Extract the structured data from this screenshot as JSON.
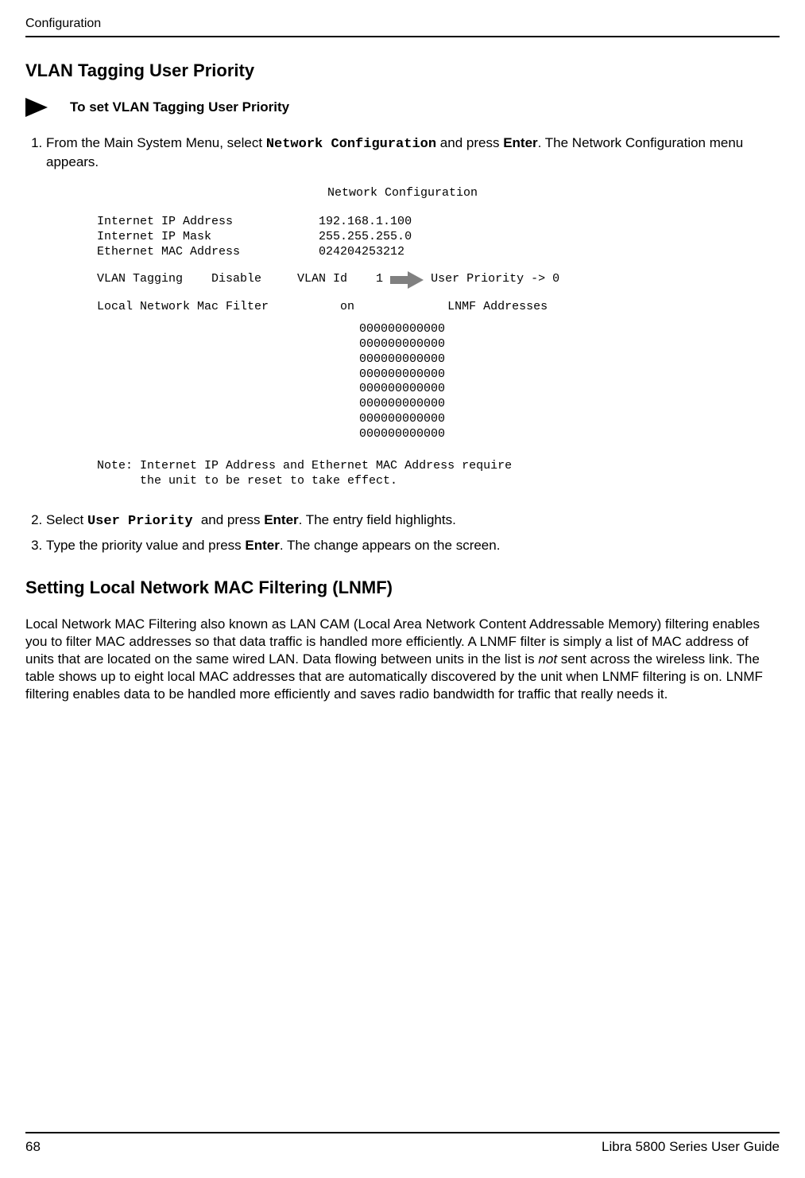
{
  "header": {
    "running": "Configuration"
  },
  "section1": {
    "title": "VLAN Tagging User Priority",
    "proc_title": "To set VLAN Tagging User Priority",
    "step1_a": "From the Main System Menu, select ",
    "step1_mono": "Network Configuration",
    "step1_b": " and press ",
    "step1_bold": "Enter",
    "step1_c": ".  The Network Configuration menu appears."
  },
  "screenshot": {
    "title": "Network Configuration",
    "lines_block1": [
      "Internet IP Address            192.168.1.100",
      "Internet IP Mask               255.255.255.0",
      "Ethernet MAC Address           024204253212"
    ],
    "vlan_left": "VLAN Tagging    Disable     VLAN Id    1 ",
    "vlan_right": " User Priority -> 0",
    "lnmf_line": "Local Network Mac Filter          on             LNMF Addresses",
    "lnmf_addrs": [
      "000000000000",
      "000000000000",
      "000000000000",
      "000000000000",
      "000000000000",
      "000000000000",
      "000000000000",
      "000000000000"
    ],
    "note1": "Note: Internet IP Address and Ethernet MAC Address require",
    "note2": "      the unit to be reset to take effect."
  },
  "after_ss": {
    "step2_a": "Select ",
    "step2_mono": "User Priority ",
    "step2_b": "and press ",
    "step2_bold": "Enter",
    "step2_c": ". The entry field highlights.",
    "step3_a": "Type the priority value and press ",
    "step3_bold": "Enter",
    "step3_b": ". The change appears on the screen."
  },
  "section2": {
    "title": "Setting Local Network MAC Filtering (LNMF)",
    "para_a": "Local Network MAC Filtering also known as LAN CAM (Local Area Network Content Addressable Memory) filtering enables you to filter MAC addresses so that data traffic is handled more efficiently. A LNMF filter is simply a list of MAC address of units that are located on the same wired LAN. Data flowing between units in the list is ",
    "para_italic": "not",
    "para_b": " sent across the wireless link. The table shows up to eight local MAC addresses that are automatically discovered by the unit when LNMF filtering is on. LNMF filtering enables data to be handled more efficiently and saves radio bandwidth for traffic that really needs it."
  },
  "footer": {
    "page": "68",
    "book": "Libra 5800 Series User Guide"
  }
}
